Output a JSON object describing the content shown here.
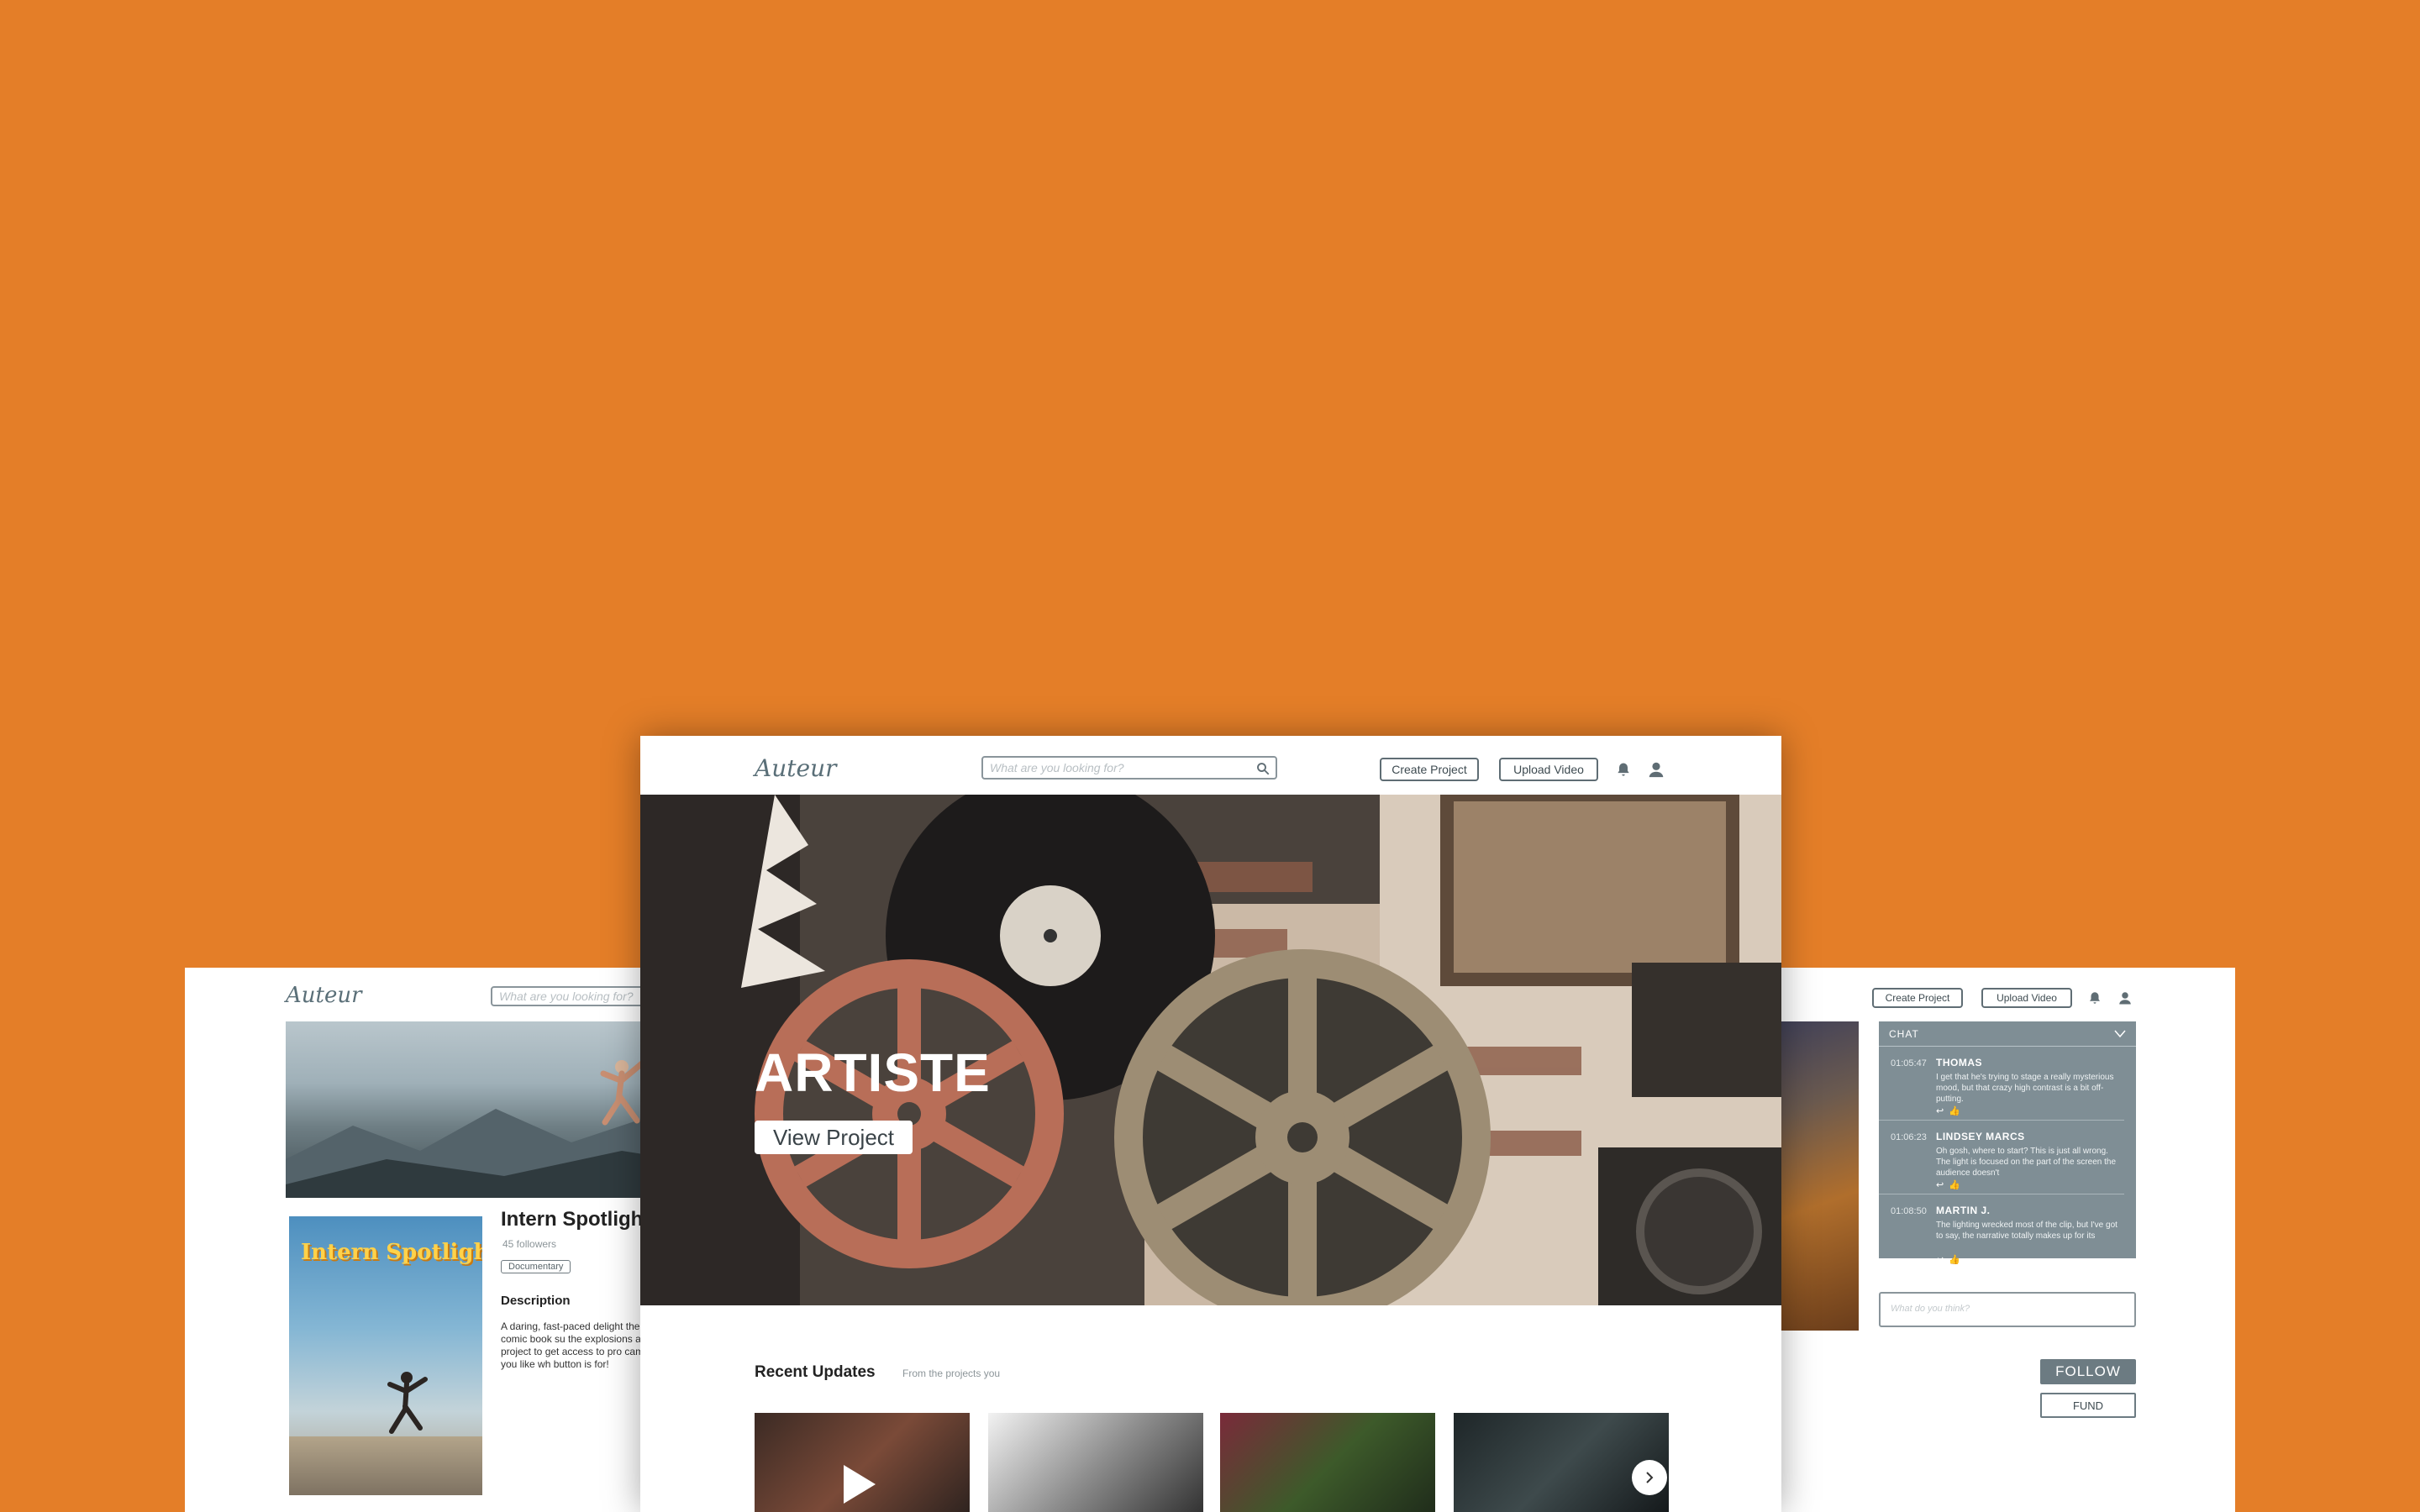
{
  "app": {
    "logo": "Auteur"
  },
  "search": {
    "placeholder": "What are you looking for?"
  },
  "nav": {
    "create_project": "Create Project",
    "upload_video": "Upload Video"
  },
  "hero": {
    "title": "ARTISTE",
    "button": "View Project"
  },
  "recent": {
    "heading": "Recent Updates",
    "subheading": "From the projects you"
  },
  "project": {
    "title": "Intern Spotlight",
    "poster_title": "Intern Spotlight",
    "followers": "45 followers",
    "tag": "Documentary",
    "description_heading": "Description",
    "description": "A daring, fast-paced delight the popular comic book su the explosions are larger ar project to get access to pro cameras. And if you like wh button is for!"
  },
  "chat": {
    "title": "CHAT",
    "messages": [
      {
        "time": "01:05:47",
        "name": "THOMAS",
        "text": "I get that he's trying to stage a really mysterious mood, but that crazy high contrast is a bit off-putting."
      },
      {
        "time": "01:06:23",
        "name": "LINDSEY MARCS",
        "text": "Oh gosh, where to start? This is just all wrong. The light is focused on the part of the screen the audience doesn't"
      },
      {
        "time": "01:08:50",
        "name": "MARTIN J.",
        "text": "The lighting wrecked most of the clip, but I've got to say, the narrative totally makes up for its"
      }
    ],
    "input_placeholder": "What do you think?"
  },
  "actions": {
    "follow": "FOLLOW",
    "fund": "FUND"
  },
  "colors": {
    "background": "#e47e28",
    "slate": "#6c7b82",
    "chat_panel": "#7f8e95"
  }
}
